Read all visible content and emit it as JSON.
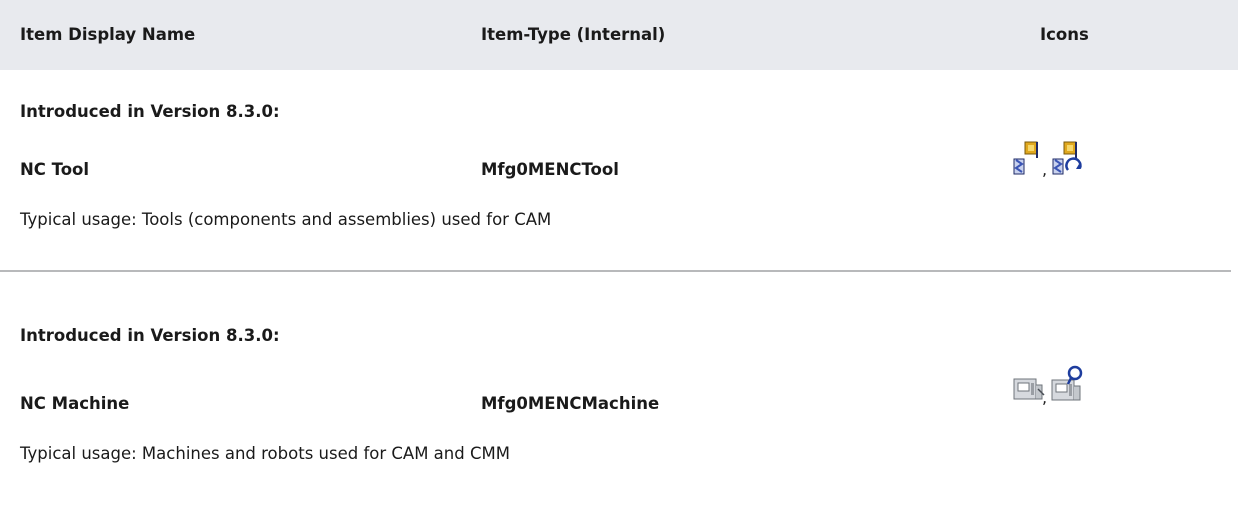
{
  "table": {
    "headers": {
      "display_name": "Item Display Name",
      "item_type": "Item-Type (Internal)",
      "icons": "Icons"
    },
    "rows": [
      {
        "introduced": "Introduced in Version 8.3.0:",
        "display_name": "NC Tool",
        "item_type": "Mfg0MENCTool",
        "icons": [
          "nc-tool-icon",
          "nc-tool-revision-icon"
        ],
        "icon_separator": ",",
        "usage": "Typical usage: Tools (components and assemblies) used for CAM"
      },
      {
        "introduced": "Introduced in Version 8.3.0:",
        "display_name": "NC Machine",
        "item_type": "Mfg0MENCMachine",
        "icons": [
          "nc-machine-icon",
          "nc-machine-search-icon"
        ],
        "icon_separator": ",",
        "usage": "Typical usage: Machines and robots used for CAM and CMM"
      }
    ]
  },
  "colors": {
    "header_bg": "#e8eaee",
    "divider": "#b8b9bb",
    "tool_blue": "#3b55b5",
    "tool_gold": "#e0a81e",
    "machine_gray": "#9a9ea4"
  }
}
